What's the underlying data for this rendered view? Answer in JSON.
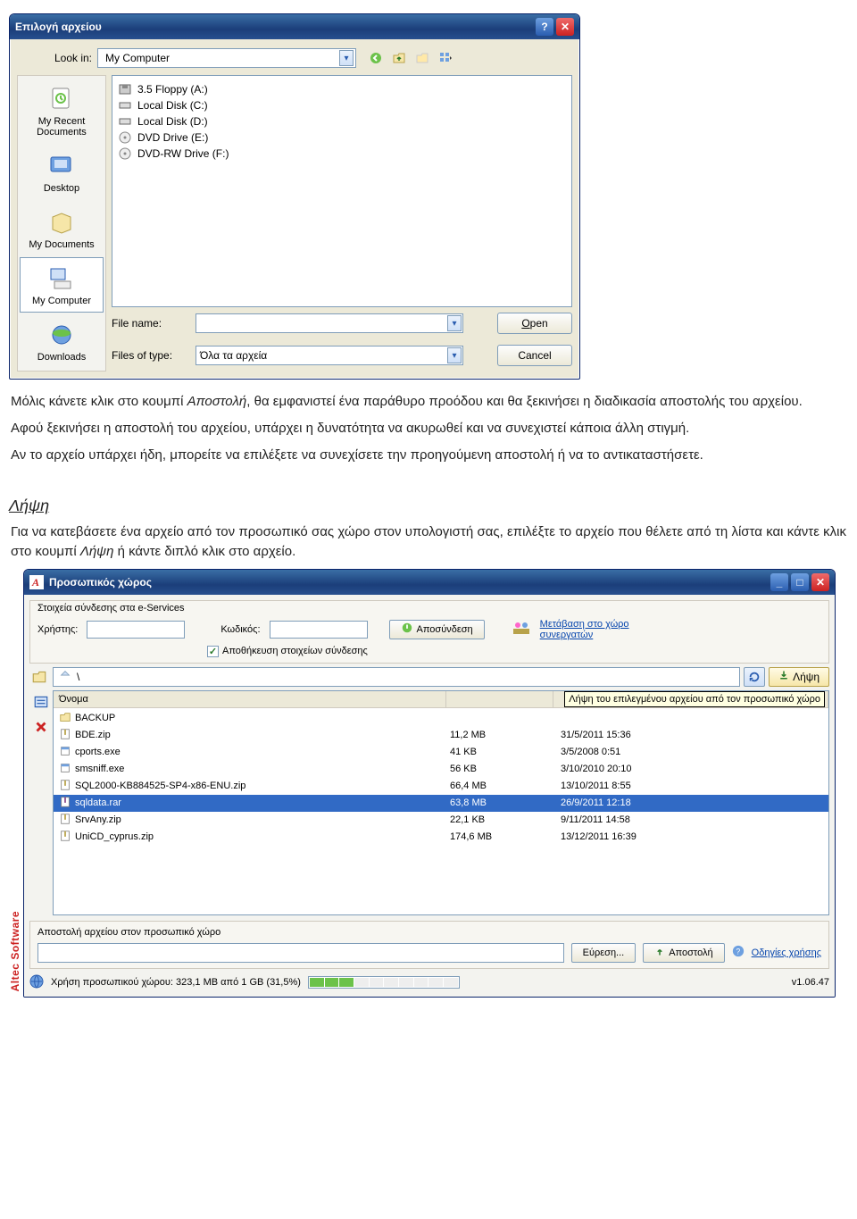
{
  "dlg1": {
    "title": "Επιλογή αρχείου",
    "look_in_label": "Look in:",
    "look_in_value": "My Computer",
    "places": [
      {
        "label": "My Recent Documents"
      },
      {
        "label": "Desktop"
      },
      {
        "label": "My Documents"
      },
      {
        "label": "My Computer"
      },
      {
        "label": "Downloads"
      }
    ],
    "drives": [
      {
        "label": "3.5 Floppy (A:)"
      },
      {
        "label": "Local Disk (C:)"
      },
      {
        "label": "Local Disk (D:)"
      },
      {
        "label": "DVD Drive (E:)"
      },
      {
        "label": "DVD-RW Drive (F:)"
      }
    ],
    "file_name_label": "File name:",
    "file_name_value": "",
    "files_of_type_label": "Files of type:",
    "files_of_type_value": "Όλα τα αρχεία",
    "open_button": "Open",
    "cancel_button": "Cancel"
  },
  "doc": {
    "p1a": "Μόλις κάνετε κλικ στο κουμπί ",
    "p1b": "Αποστολή",
    "p1c": ", θα εμφανιστεί ένα παράθυρο προόδου και θα ξεκινήσει η διαδικασία αποστολής του αρχείου.",
    "p2": "Αφού ξεκινήσει η αποστολή του αρχείου, υπάρχει η δυνατότητα να ακυρωθεί και να συνεχιστεί κάποια άλλη στιγμή.",
    "p3": "Αν το αρχείο υπάρχει ήδη, μπορείτε να επιλέξετε να συνεχίσετε την προηγούμενη αποστολή ή να το αντικαταστήσετε.",
    "h2": "Λήψη",
    "p4a": "Για να κατεβάσετε ένα αρχείο από τον προσωπικό σας χώρο στον υπολογιστή σας, επιλέξτε το αρχείο που θέλετε από τη λίστα και κάντε κλικ στο κουμπί ",
    "p4b": "Λήψη",
    "p4c": " ή κάντε διπλό κλικ στο αρχείο."
  },
  "dlg2": {
    "title": "Προσωπικός χώρος",
    "brand": "Altec Software",
    "conn_title": "Στοιχεία σύνδεσης στα e-Services",
    "user_label": "Χρήστης:",
    "pass_label": "Κωδικός:",
    "logout_btn": "Αποσύνδεση",
    "partners_link": "Μετάβαση στο χώρο συνεργατών",
    "save_creds": "Αποθήκευση στοιχείων σύνδεσης",
    "path": "\\",
    "download_btn": "Λήψη",
    "tooltip": "Λήψη του επιλεγμένου αρχείου από τον προσωπικό χώρο",
    "col_name": "Όνομα",
    "files": [
      {
        "icon": "folder",
        "name": "BACKUP",
        "size": "",
        "date": ""
      },
      {
        "icon": "zip",
        "name": "BDE.zip",
        "size": "11,2 MB",
        "date": "31/5/2011 15:36"
      },
      {
        "icon": "exe",
        "name": "cports.exe",
        "size": "41 KB",
        "date": "3/5/2008 0:51"
      },
      {
        "icon": "exe",
        "name": "smsniff.exe",
        "size": "56 KB",
        "date": "3/10/2010 20:10"
      },
      {
        "icon": "zip",
        "name": "SQL2000-KB884525-SP4-x86-ENU.zip",
        "size": "66,4 MB",
        "date": "13/10/2011 8:55"
      },
      {
        "icon": "rar",
        "name": "sqldata.rar",
        "size": "63,8 MB",
        "date": "26/9/2011 12:18",
        "sel": true
      },
      {
        "icon": "zip",
        "name": "SrvAny.zip",
        "size": "22,1 KB",
        "date": "9/11/2011 14:58"
      },
      {
        "icon": "zip",
        "name": "UniCD_cyprus.zip",
        "size": "174,6 MB",
        "date": "13/12/2011 16:39"
      }
    ],
    "upload_title": "Αποστολή αρχείου στον προσωπικό χώρο",
    "browse_btn": "Εύρεση...",
    "upload_btn": "Αποστολή",
    "help_link": "Οδηγίες χρήσης",
    "usage_text": "Χρήση προσωπικού χώρου: 323,1 MB από 1 GB (31,5%)",
    "version": "v1.06.47"
  }
}
